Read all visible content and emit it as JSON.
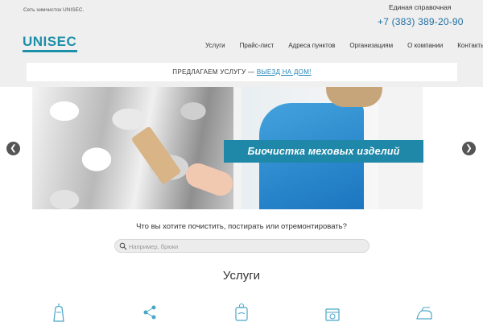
{
  "header": {
    "tagline": "Сеть химчисток UNISEC.",
    "help_label": "Единая справочная",
    "phone": "+7 (383) 389-20-90",
    "logo_text": "UNISEC"
  },
  "nav": {
    "items": [
      "Услуги",
      "Прайс-лист",
      "Адреса пунктов",
      "Организациям",
      "О компании",
      "Контакты"
    ]
  },
  "offer": {
    "text": "ПРЕДЛАГАЕМ УСЛУГУ —",
    "link": "ВЫЕЗД НА ДОМ!"
  },
  "slider": {
    "caption": "Биочистка меховых изделий",
    "prev_icon": "chevron-left-icon",
    "next_icon": "chevron-right-icon"
  },
  "search": {
    "question": "Что вы хотите почистить, постирать или отремонтировать?",
    "placeholder": "Например, брюки",
    "icon": "search-icon"
  },
  "services": {
    "title": "Услуги",
    "icons": [
      "garment-bag-icon",
      "molecule-icon",
      "washing-icon",
      "laundry-machine-icon",
      "iron-icon"
    ]
  },
  "colors": {
    "accent": "#1e8fa8",
    "link": "#1f84b8",
    "topbar_bg": "#efefef"
  }
}
